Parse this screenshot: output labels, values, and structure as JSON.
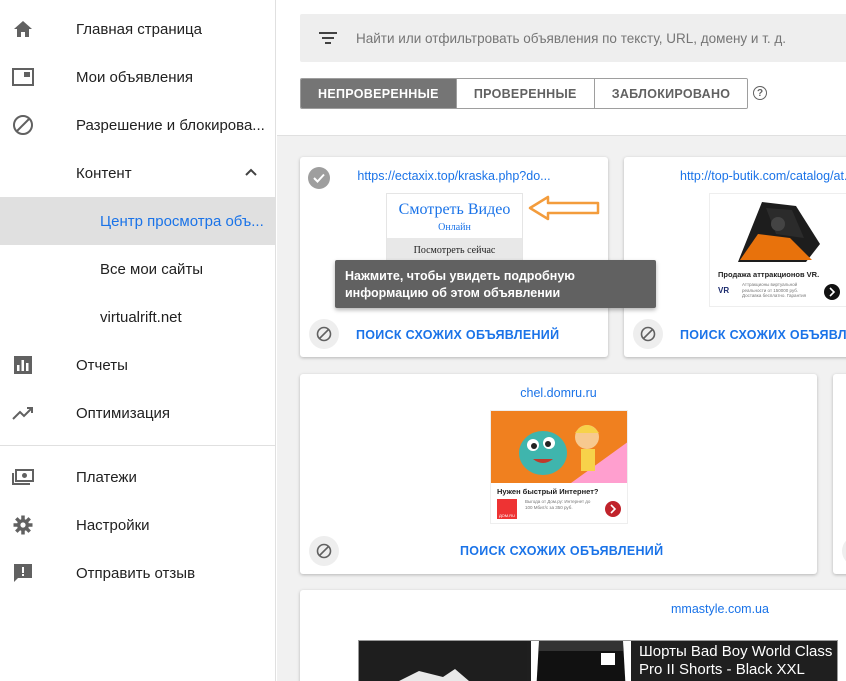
{
  "sidebar": {
    "items": [
      {
        "label": "Главная страница",
        "icon": "home-icon"
      },
      {
        "label": "Мои объявления",
        "icon": "ads-icon"
      },
      {
        "label": "Разрешение и блокирова...",
        "icon": "block-icon"
      },
      {
        "label": "Контент",
        "icon": ""
      },
      {
        "label": "Центр просмотра объ...",
        "icon": ""
      },
      {
        "label": "Все мои сайты",
        "icon": ""
      },
      {
        "label": "virtualrift.net",
        "icon": ""
      },
      {
        "label": "Отчеты",
        "icon": "reports-icon"
      },
      {
        "label": "Оптимизация",
        "icon": "trending-icon"
      },
      {
        "label": "Платежи",
        "icon": "payments-icon"
      },
      {
        "label": "Настройки",
        "icon": "settings-icon"
      },
      {
        "label": "Отправить отзыв",
        "icon": "feedback-icon"
      }
    ]
  },
  "search": {
    "placeholder": "Найти или отфильтровать объявления по тексту, URL, домену и т. д."
  },
  "tabs": [
    "НЕПРОВЕРЕННЫЕ",
    "ПРОВЕРЕННЫЕ",
    "ЗАБЛОКИРОВАНО"
  ],
  "tabs_active": 0,
  "help_glyph": "?",
  "cards": [
    {
      "url": "https://ectaxix.top/kraska.php?do...",
      "similar": "ПОИСК СХОЖИХ ОБЪЯВЛЕНИЙ",
      "ad": {
        "title": "Смотреть Видео",
        "subtitle": "Онлайн",
        "button": "Посмотреть сейчас"
      }
    },
    {
      "url": "http://top-butik.com/catalog/at...",
      "similar": "ПОИСК СХОЖИХ ОБЪЯВЛЕНИЙ",
      "ad": {
        "headline": "Продажа аттракционов VR.",
        "body": "Аттракционы виртуальной реальности от 150000 руб. Доставка бесплатно. Гарантия",
        "brand": "VR"
      }
    },
    {
      "url": "chel.domru.ru",
      "similar": "ПОИСК СХОЖИХ ОБЪЯВЛЕНИЙ",
      "ad": {
        "headline": "Нужен быстрый Интернет?",
        "body": "Выгода от Дом.ру: Интернет до 100 Мбит/с за 350 руб.",
        "brand": "ДОМ.RU"
      }
    },
    {
      "url": "mmastyle.com.ua",
      "ad": {
        "headline": "Шорты Bad Boy World Class Pro II Shorts - Black XXL"
      }
    }
  ],
  "tooltip": {
    "text": "Нажмите, чтобы увидеть подробную информацию об этом объявлении"
  },
  "colors": {
    "accent": "#1a73e8",
    "arrow": "#f39c3c",
    "active_tab": "#757575"
  }
}
